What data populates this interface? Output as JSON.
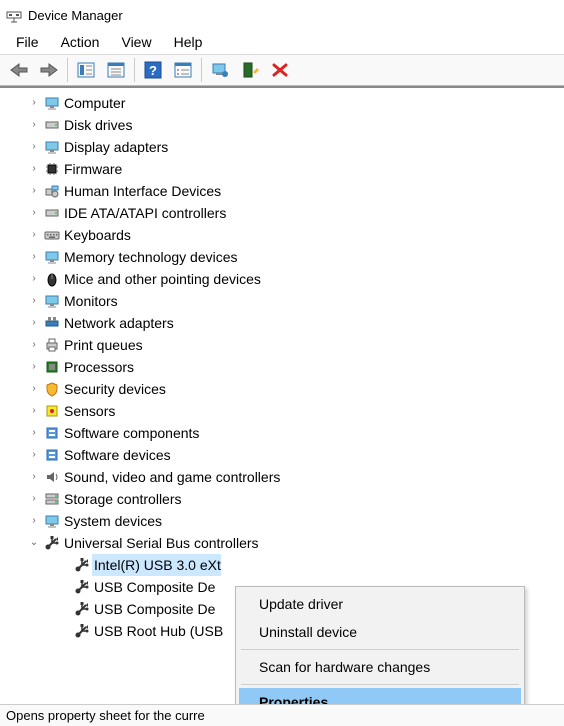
{
  "window": {
    "title": "Device Manager"
  },
  "menubar": {
    "items": [
      "File",
      "Action",
      "View",
      "Help"
    ]
  },
  "toolbar": {
    "back": "Back",
    "forward": "Forward",
    "show_hide": "Show/Hide Console Tree",
    "prop_icon": "Properties",
    "help": "Help",
    "action_icon": "Action",
    "update": "Update",
    "scan": "Scan for hardware changes",
    "uninstall": "Uninstall"
  },
  "tree": {
    "indent": 26,
    "nodes": [
      {
        "label": "Computer",
        "icon": "monitor"
      },
      {
        "label": "Disk drives",
        "icon": "drive"
      },
      {
        "label": "Display adapters",
        "icon": "monitor"
      },
      {
        "label": "Firmware",
        "icon": "chip"
      },
      {
        "label": "Human Interface Devices",
        "icon": "hid"
      },
      {
        "label": "IDE ATA/ATAPI controllers",
        "icon": "drive"
      },
      {
        "label": "Keyboards",
        "icon": "keyboard"
      },
      {
        "label": "Memory technology devices",
        "icon": "monitor"
      },
      {
        "label": "Mice and other pointing devices",
        "icon": "mouse"
      },
      {
        "label": "Monitors",
        "icon": "monitor"
      },
      {
        "label": "Network adapters",
        "icon": "net"
      },
      {
        "label": "Print queues",
        "icon": "printer"
      },
      {
        "label": "Processors",
        "icon": "cpu"
      },
      {
        "label": "Security devices",
        "icon": "shield"
      },
      {
        "label": "Sensors",
        "icon": "sensor"
      },
      {
        "label": "Software components",
        "icon": "soft"
      },
      {
        "label": "Software devices",
        "icon": "soft"
      },
      {
        "label": "Sound, video and game controllers",
        "icon": "sound"
      },
      {
        "label": "Storage controllers",
        "icon": "storage"
      },
      {
        "label": "System devices",
        "icon": "monitor"
      }
    ],
    "expanded_node": {
      "label": "Universal Serial Bus controllers",
      "icon": "usb",
      "children": [
        {
          "label": "Intel(R) USB 3.0 eXt",
          "icon": "usb",
          "selected": true,
          "truncated": true
        },
        {
          "label": "USB Composite De",
          "icon": "usb",
          "truncated": true
        },
        {
          "label": "USB Composite De",
          "icon": "usb",
          "truncated": true
        },
        {
          "label": "USB Root Hub (USB",
          "icon": "usb",
          "truncated": true
        }
      ]
    }
  },
  "context_menu": {
    "items": [
      {
        "label": "Update driver",
        "type": "item"
      },
      {
        "label": "Uninstall device",
        "type": "item"
      },
      {
        "type": "sep"
      },
      {
        "label": "Scan for hardware changes",
        "type": "item"
      },
      {
        "type": "sep"
      },
      {
        "label": "Properties",
        "type": "item",
        "highlight": true
      }
    ]
  },
  "status": {
    "text": "Opens property sheet for the curre"
  },
  "icons": {
    "chevron_right": "›",
    "chevron_down": "∨"
  }
}
